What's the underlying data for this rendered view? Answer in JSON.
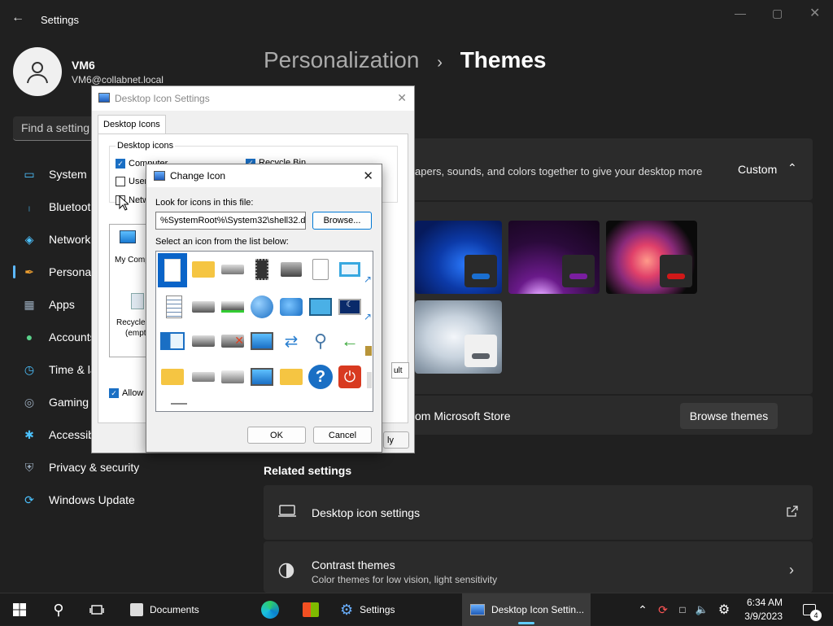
{
  "settings": {
    "title": "Settings",
    "user": {
      "name": "VM6",
      "email": "VM6@collabnet.local"
    },
    "search_placeholder": "Find a setting",
    "nav": [
      {
        "label": "System",
        "icon": "monitor-icon"
      },
      {
        "label": "Bluetooth & devices",
        "icon": "bluetooth-icon"
      },
      {
        "label": "Network & internet",
        "icon": "wifi-icon"
      },
      {
        "label": "Personalization",
        "icon": "brush-icon"
      },
      {
        "label": "Apps",
        "icon": "apps-icon"
      },
      {
        "label": "Accounts",
        "icon": "person-icon"
      },
      {
        "label": "Time & language",
        "icon": "clock-globe-icon"
      },
      {
        "label": "Gaming",
        "icon": "gamepad-icon"
      },
      {
        "label": "Accessibility",
        "icon": "accessibility-icon"
      },
      {
        "label": "Privacy & security",
        "icon": "shield-icon"
      },
      {
        "label": "Windows Update",
        "icon": "update-icon"
      }
    ],
    "breadcrumb": {
      "parent": "Personalization",
      "current": "Themes"
    },
    "current_theme": {
      "description": "apers, sounds, and colors together to give your desktop more",
      "value": "Custom"
    },
    "store_text": "om Microsoft Store",
    "browse_themes": "Browse themes",
    "related_heading": "Related settings",
    "related": [
      {
        "title": "Desktop icon settings",
        "subtitle": ""
      },
      {
        "title": "Contrast themes",
        "subtitle": "Color themes for low vision, light sensitivity"
      }
    ],
    "theme_colors": [
      "#1a6fd1",
      "#7a1ea0",
      "#d01818",
      "#5a5f66"
    ]
  },
  "desktop_icon_settings": {
    "title": "Desktop Icon Settings",
    "tab": "Desktop Icons",
    "group": "Desktop icons",
    "items": [
      {
        "label": "Computer",
        "checked": true
      },
      {
        "label": "Recycle Bin",
        "checked": true
      },
      {
        "label": "User",
        "checked": false
      },
      {
        "label": "Netw",
        "checked": false
      }
    ],
    "preview": [
      "My Comp",
      "Recycle",
      "(empt"
    ],
    "default_btn": "ult",
    "allow_label": "Allow t",
    "apply_btn": "ly"
  },
  "change_icon": {
    "title": "Change Icon",
    "look_label": "Look for icons in this file:",
    "file_path": "%SystemRoot%\\System32\\shell32.d",
    "browse_btn": "Browse...",
    "select_label": "Select an icon from the list below:",
    "ok_btn": "OK",
    "cancel_btn": "Cancel"
  },
  "taskbar": {
    "apps": [
      {
        "label": "Documents",
        "active": false
      },
      {
        "label": "Settings",
        "active": false
      },
      {
        "label": "Desktop Icon Settin...",
        "active": true
      }
    ],
    "time": "6:34 AM",
    "date": "3/9/2023",
    "notifications": "4"
  }
}
